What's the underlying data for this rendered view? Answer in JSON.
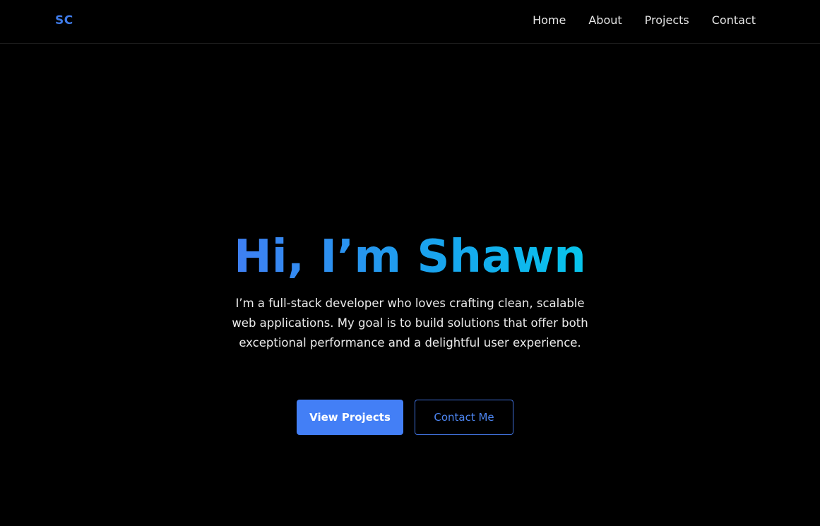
{
  "header": {
    "logo": "SC",
    "nav": [
      {
        "label": "Home"
      },
      {
        "label": "About"
      },
      {
        "label": "Projects"
      },
      {
        "label": "Contact"
      }
    ]
  },
  "hero": {
    "title": "Hi, I’m Shawn",
    "description": "I’m a full-stack developer who loves crafting clean, scalable web applications. My goal is to build solutions that offer both exceptional performance and a delightful user experience.",
    "primary_button": "View Projects",
    "secondary_button": "Contact Me"
  },
  "colors": {
    "background": "#000000",
    "accent": "#437ff6",
    "gradient_start": "#3f7ff2",
    "gradient_end": "#07c5ec",
    "text": "#ececec"
  }
}
